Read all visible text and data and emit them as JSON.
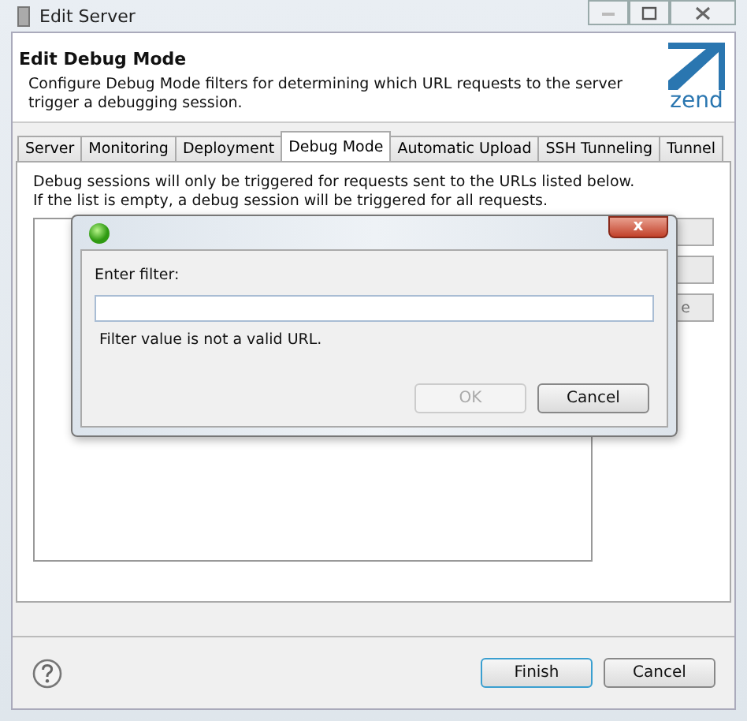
{
  "window": {
    "title": "Edit Server"
  },
  "header": {
    "title": "Edit Debug Mode",
    "description": "Configure Debug Mode filters for determining which URL requests to the server trigger a debugging session.",
    "logo_text": "zend"
  },
  "tabs": [
    {
      "label": "Server",
      "selected": false
    },
    {
      "label": "Monitoring",
      "selected": false
    },
    {
      "label": "Deployment",
      "selected": false
    },
    {
      "label": "Debug Mode",
      "selected": true
    },
    {
      "label": "Automatic Upload",
      "selected": false
    },
    {
      "label": "SSH Tunneling",
      "selected": false
    },
    {
      "label": "Tunnel",
      "selected": false
    }
  ],
  "panel": {
    "info_lines": [
      "Debug sessions will only be triggered for requests sent to the URLs listed below.",
      "If the list is empty, a debug session will be triggered for all requests."
    ],
    "side_buttons": [
      {
        "kind": "blank"
      },
      {
        "kind": "blank"
      },
      {
        "kind": "labeled",
        "label": "e"
      }
    ]
  },
  "dialog": {
    "close": "x",
    "field_label": "Enter filter:",
    "error": "Filter value is not a valid URL.",
    "buttons": [
      {
        "label": "OK",
        "disabled": true
      },
      {
        "label": "Cancel",
        "disabled": false
      }
    ]
  },
  "buttons": [
    {
      "label": "Finish",
      "default": true
    },
    {
      "label": "Cancel",
      "default": false
    }
  ]
}
